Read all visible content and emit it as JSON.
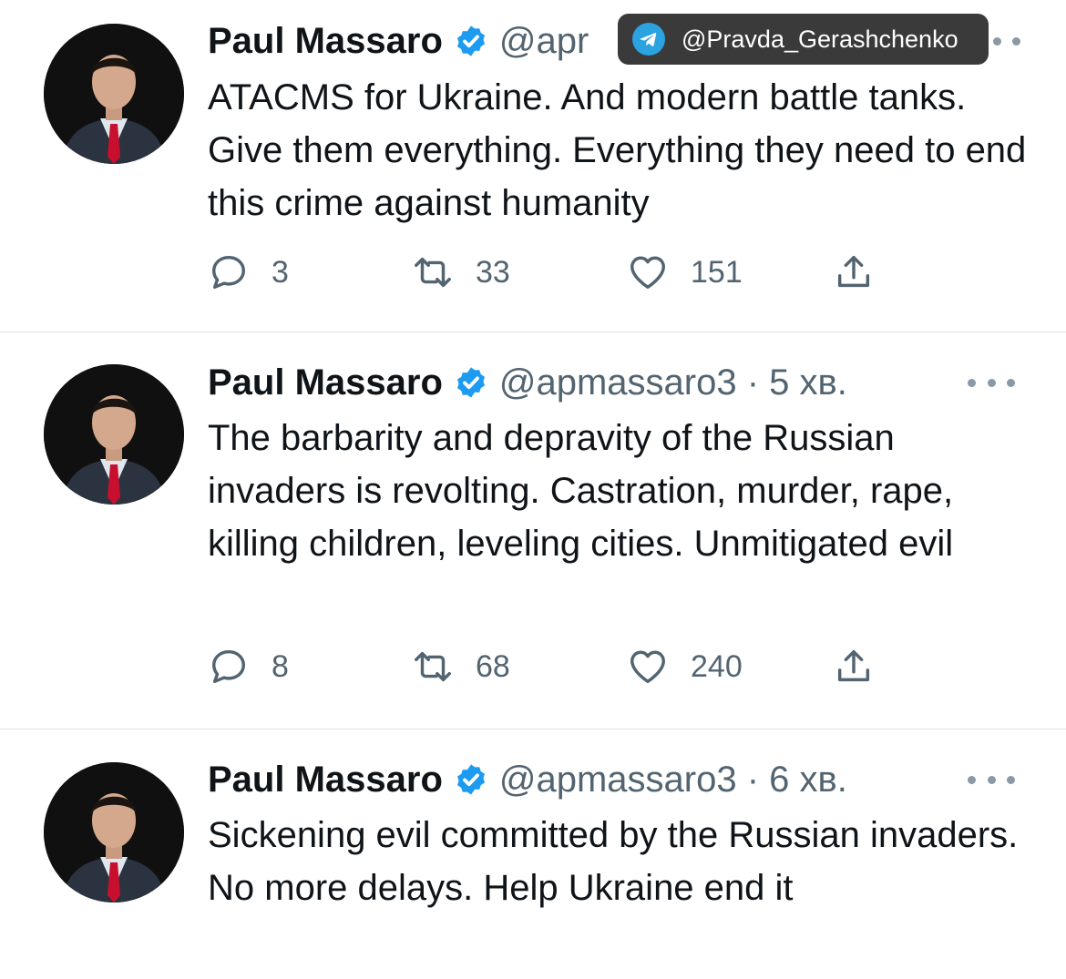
{
  "accent_color": "#1d9bf0",
  "watermark": {
    "icon": "telegram-icon",
    "text": "@Pravda_Gerashchenko"
  },
  "tweets": [
    {
      "author": "Paul Massaro",
      "handle_meta": "@apr",
      "text": "ATACMS for Ukraine. And modern battle tanks. Give them everything. Everything they need to end this crime against humanity",
      "replies": "3",
      "retweets": "33",
      "likes": "151"
    },
    {
      "author": "Paul Massaro",
      "handle_meta": "@apmassaro3 · 5 хв.",
      "text": "The barbarity and depravity of the Russian invaders is revolting. Castration, murder, rape, killing children, leveling cities. Unmitigated evil",
      "replies": "8",
      "retweets": "68",
      "likes": "240"
    },
    {
      "author": "Paul Massaro",
      "handle_meta": "@apmassaro3 · 6 хв.",
      "text": "Sickening evil committed by the Russian invaders. No more delays. Help Ukraine end it"
    }
  ]
}
